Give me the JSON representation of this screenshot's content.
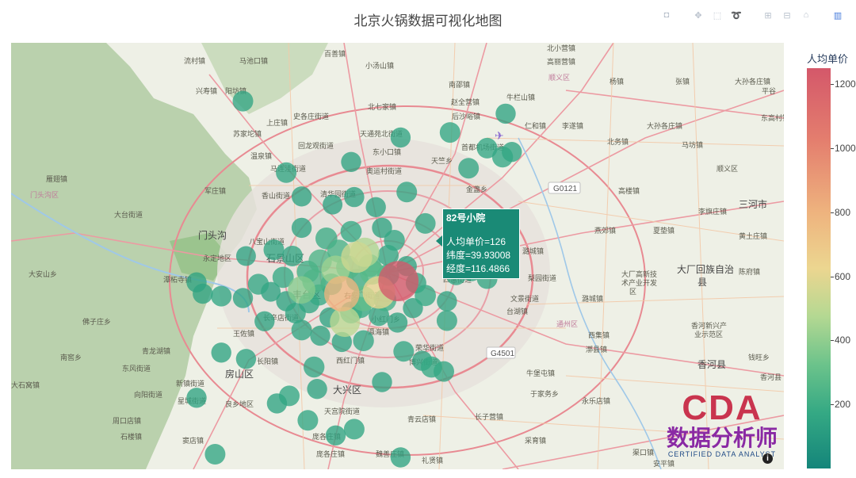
{
  "chart_data": {
    "type": "scatter",
    "subtype": "scatter_mapbox",
    "title": "北京火锅数据可视化地图",
    "colorbar": {
      "title": "人均单价",
      "range": [
        0,
        1250
      ],
      "ticks": [
        200,
        400,
        600,
        800,
        1000,
        1200
      ],
      "colorscale": [
        "#14857a",
        "#35a984",
        "#6cc38b",
        "#b4d892",
        "#ecd690",
        "#eeb37e",
        "#e47e6e",
        "#d4586a"
      ]
    },
    "hover": {
      "name": "82号小院",
      "price_label": "人均单价=126",
      "lat_label": "纬度=39.93008",
      "lon_label": "经度=116.4866"
    },
    "map_bounds": {
      "lon": [
        115.86,
        117.11
      ],
      "lat": [
        39.63,
        40.31
      ]
    },
    "points": [
      [
        116.4866,
        39.93008,
        1250
      ],
      [
        116.395,
        39.91,
        880
      ],
      [
        116.419,
        39.968,
        620
      ],
      [
        116.4,
        39.865,
        560
      ],
      [
        116.455,
        39.912,
        700
      ],
      [
        116.385,
        39.948,
        480
      ],
      [
        116.33,
        39.916,
        420
      ],
      [
        116.432,
        39.976,
        520
      ],
      [
        116.36,
        39.962,
        250
      ],
      [
        116.34,
        39.945,
        210
      ],
      [
        116.3,
        39.936,
        180
      ],
      [
        116.315,
        39.97,
        160
      ],
      [
        116.37,
        39.998,
        200
      ],
      [
        116.41,
        40.009,
        180
      ],
      [
        116.46,
        40.015,
        150
      ],
      [
        116.48,
        39.995,
        170
      ],
      [
        116.44,
        39.955,
        230
      ],
      [
        116.42,
        39.932,
        210
      ],
      [
        116.378,
        39.925,
        190
      ],
      [
        116.358,
        39.908,
        180
      ],
      [
        116.342,
        39.895,
        160
      ],
      [
        116.305,
        39.898,
        150
      ],
      [
        116.28,
        39.913,
        140
      ],
      [
        116.26,
        39.925,
        170
      ],
      [
        116.425,
        39.888,
        180
      ],
      [
        116.455,
        39.875,
        160
      ],
      [
        116.485,
        39.864,
        150
      ],
      [
        116.51,
        39.887,
        150
      ],
      [
        116.53,
        39.907,
        180
      ],
      [
        116.515,
        39.927,
        160
      ],
      [
        116.5,
        39.954,
        150
      ],
      [
        116.47,
        39.971,
        170
      ],
      [
        116.33,
        39.852,
        160
      ],
      [
        116.36,
        39.843,
        150
      ],
      [
        116.395,
        39.833,
        150
      ],
      [
        116.43,
        39.835,
        170
      ],
      [
        116.495,
        39.818,
        160
      ],
      [
        116.525,
        39.803,
        150
      ],
      [
        116.54,
        39.793,
        180
      ],
      [
        116.56,
        39.786,
        160
      ],
      [
        116.45,
        40.048,
        150
      ],
      [
        116.5,
        40.072,
        160
      ],
      [
        116.415,
        40.064,
        150
      ],
      [
        116.38,
        40.052,
        140
      ],
      [
        116.33,
        40.065,
        150
      ],
      [
        116.63,
        40.142,
        160
      ],
      [
        116.655,
        40.128,
        170
      ],
      [
        116.67,
        40.136,
        150
      ],
      [
        116.57,
        40.167,
        160
      ],
      [
        116.66,
        40.197,
        150
      ],
      [
        116.6,
        40.11,
        160
      ],
      [
        116.235,
        40.217,
        160
      ],
      [
        116.235,
        39.903,
        150
      ],
      [
        116.2,
        39.906,
        160
      ],
      [
        116.17,
        39.91,
        150
      ],
      [
        116.31,
        39.747,
        160
      ],
      [
        116.29,
        39.735,
        150
      ],
      [
        116.34,
        39.708,
        160
      ],
      [
        116.355,
        39.758,
        150
      ],
      [
        116.35,
        39.793,
        170
      ],
      [
        116.24,
        39.806,
        150
      ],
      [
        116.2,
        39.816,
        150
      ],
      [
        116.16,
        39.744,
        150
      ],
      [
        116.19,
        39.654,
        160
      ],
      [
        116.33,
        40.015,
        150
      ],
      [
        116.285,
        39.98,
        160
      ],
      [
        116.24,
        39.97,
        140
      ],
      [
        116.16,
        39.928,
        150
      ],
      [
        116.58,
        39.94,
        160
      ],
      [
        116.605,
        39.946,
        150
      ],
      [
        116.63,
        39.934,
        160
      ],
      [
        116.565,
        39.898,
        150
      ],
      [
        116.49,
        40.159,
        150
      ],
      [
        116.53,
        40.022,
        160
      ],
      [
        116.41,
        40.12,
        150
      ],
      [
        116.305,
        40.103,
        160
      ],
      [
        116.415,
        39.694,
        160
      ],
      [
        116.49,
        39.649,
        150
      ],
      [
        116.385,
        39.684,
        150
      ],
      [
        116.46,
        39.769,
        150
      ],
      [
        116.565,
        39.867,
        160
      ],
      [
        116.375,
        39.872,
        150
      ],
      [
        116.32,
        39.879,
        160
      ],
      [
        116.27,
        39.866,
        150
      ],
      [
        116.444,
        39.944,
        300
      ],
      [
        116.405,
        39.952,
        270
      ],
      [
        116.39,
        39.978,
        240
      ],
      [
        116.43,
        39.902,
        320
      ],
      [
        116.47,
        39.94,
        200
      ],
      [
        116.35,
        39.93,
        260
      ],
      [
        116.465,
        39.9,
        220
      ],
      [
        116.41,
        39.88,
        200
      ]
    ]
  }
}
